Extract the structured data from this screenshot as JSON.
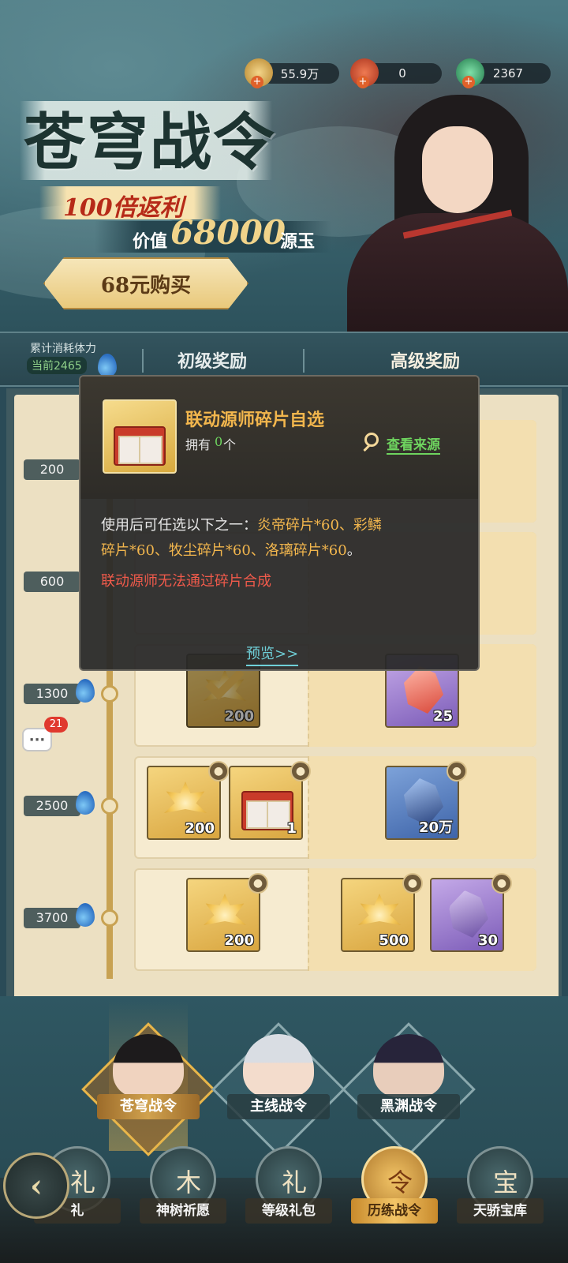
{
  "currencies": [
    {
      "name": "coin-icon",
      "value": "55.9万",
      "color": "#d9a640"
    },
    {
      "name": "red-gem-icon",
      "value": "0",
      "color": "#d24a2c"
    },
    {
      "name": "green-gem-icon",
      "value": "2367",
      "color": "#3aa36a"
    }
  ],
  "banner": {
    "title": "苍穹战令",
    "promo": "100倍返利",
    "value_prefix": "价值",
    "value_amount": "68000",
    "value_suffix": "源玉",
    "buy_label": "68元购买"
  },
  "tabs": {
    "cumulative_label": "累计消耗体力",
    "current_label": "当前2465",
    "basic": "初级奖励",
    "advanced": "高级奖励"
  },
  "tiers": [
    {
      "threshold": "200"
    },
    {
      "threshold": "600"
    },
    {
      "threshold": "1300"
    },
    {
      "threshold": "2500"
    },
    {
      "threshold": "3700"
    }
  ],
  "rewards": {
    "r1_basic_count": "200",
    "r1_adv_count": "25",
    "r2_basic_a": "200",
    "r2_basic_b": "1",
    "r2_adv_count": "20万",
    "r3_basic_count": "200",
    "r3_adv_a": "500",
    "r3_adv_b": "30",
    "faded_1": "1",
    "faded_2": "200"
  },
  "chat": {
    "badge": "21",
    "glyph": "···"
  },
  "tooltip": {
    "item_name": "联动源师碎片自选",
    "own_prefix": "拥有",
    "own_count": "0",
    "own_suffix": "个",
    "source_link": "查看来源",
    "desc_intro": "使用后可任选以下之一：",
    "desc_opt1": "炎帝碎片*60、彩鳞",
    "desc_opt2": "碎片*60、牧尘碎片*60、洛璃碎片*60",
    "desc_end": "。",
    "warning": "联动源师无法通过碎片合成",
    "preview": "预览>>"
  },
  "character_tabs": [
    {
      "label": "苍穹战令",
      "active": true
    },
    {
      "label": "主线战令",
      "active": false
    },
    {
      "label": "黑渊战令",
      "active": false
    }
  ],
  "nav": [
    {
      "label": "礼",
      "glyph": "礼"
    },
    {
      "label": "神树祈愿",
      "glyph": "木"
    },
    {
      "label": "等级礼包",
      "glyph": "礼"
    },
    {
      "label": "历练战令",
      "glyph": "令",
      "active": true
    },
    {
      "label": "天骄宝库",
      "glyph": "宝"
    }
  ],
  "colors": {
    "accent_gold": "#e8b64a",
    "highlight_orange": "#f2b64d",
    "warning_red": "#f05a4b",
    "link_green": "#6ed45f"
  }
}
